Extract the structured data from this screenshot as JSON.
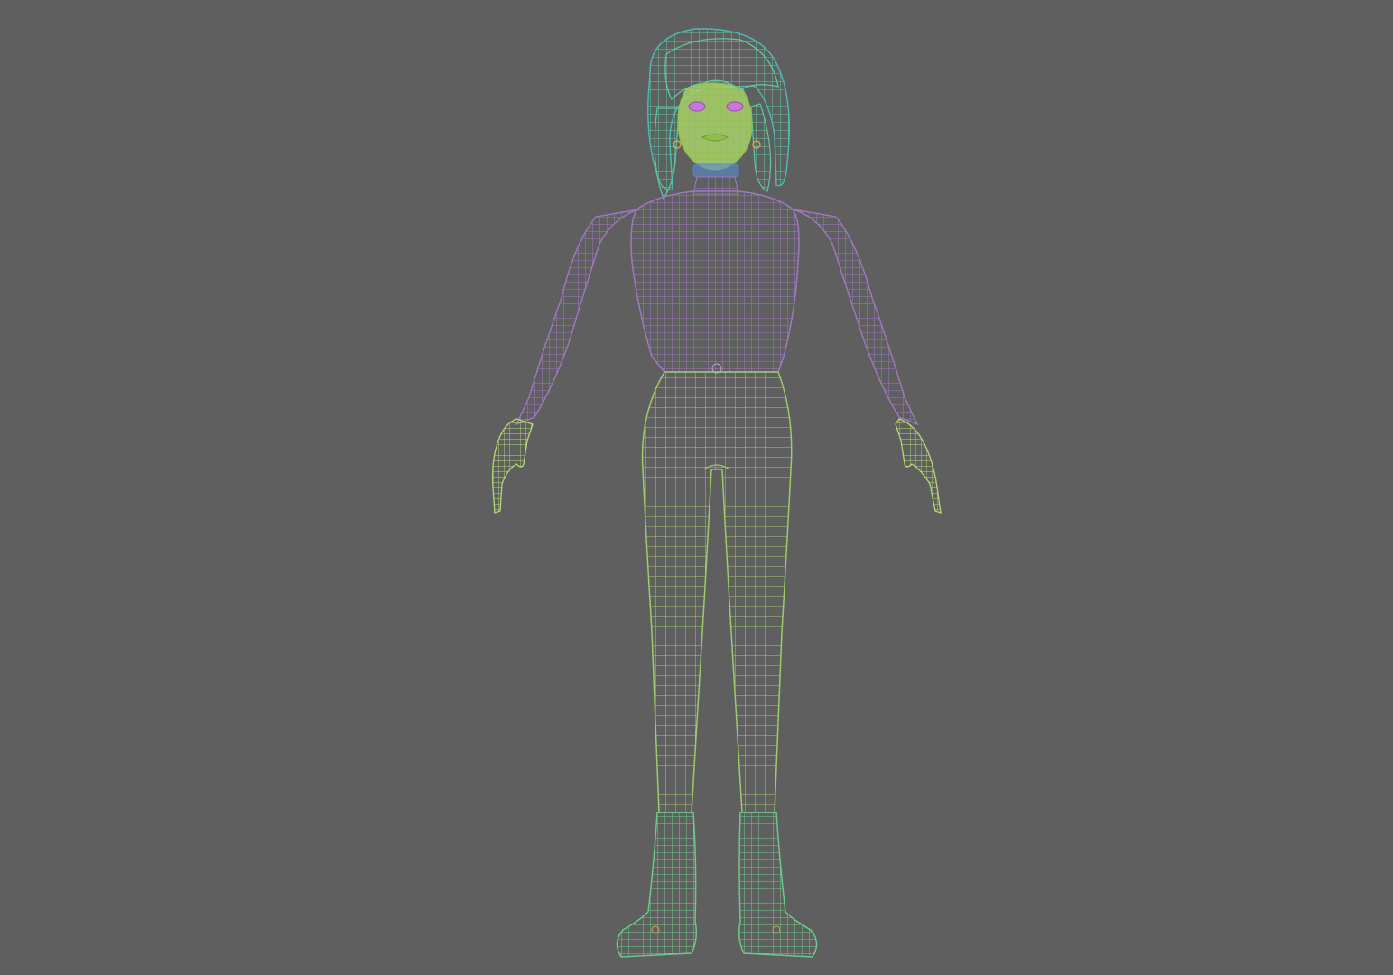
{
  "viewport": {
    "background_color": "#5f5f5f",
    "subject": "wireframe-character-a-pose"
  },
  "mesh_colors": {
    "hair": "#5cc9a0",
    "hair_back": "#4ab9b0",
    "face": "#a8d26a",
    "eyes": "#c878d8",
    "neck_collar": "#5a8ad0",
    "top_shirt": "#a178c0",
    "hands": "#b4d873",
    "pants": "#9ccc6a",
    "boots": "#6cc98a",
    "earring": "#d9a050"
  }
}
